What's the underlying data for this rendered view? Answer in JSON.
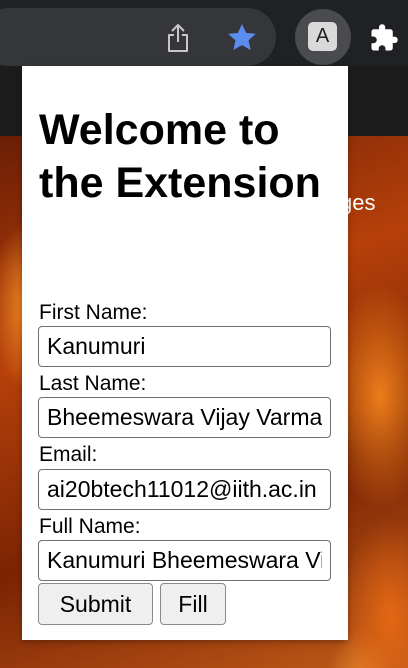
{
  "browser": {
    "extension_letter": "A"
  },
  "background_page": {
    "partial_text": "ges"
  },
  "popup": {
    "title": "Welcome to the Extension",
    "fields": [
      {
        "label": "First Name:",
        "value": "Kanumuri"
      },
      {
        "label": "Last Name:",
        "value": "Bheemeswara Vijay Varma"
      },
      {
        "label": "Email:",
        "value": "ai20btech11012@iith.ac.in"
      },
      {
        "label": "Full Name:",
        "value": "Kanumuri Bheemeswara Vijay Varma"
      }
    ],
    "buttons": {
      "submit_label": "Submit",
      "fill_label": "Fill"
    }
  },
  "colors": {
    "star": "#5b8def",
    "toolbar": "#202124"
  },
  "icons": [
    "share-icon",
    "bookmark-star-icon",
    "extension-icon",
    "puzzle-icon"
  ]
}
